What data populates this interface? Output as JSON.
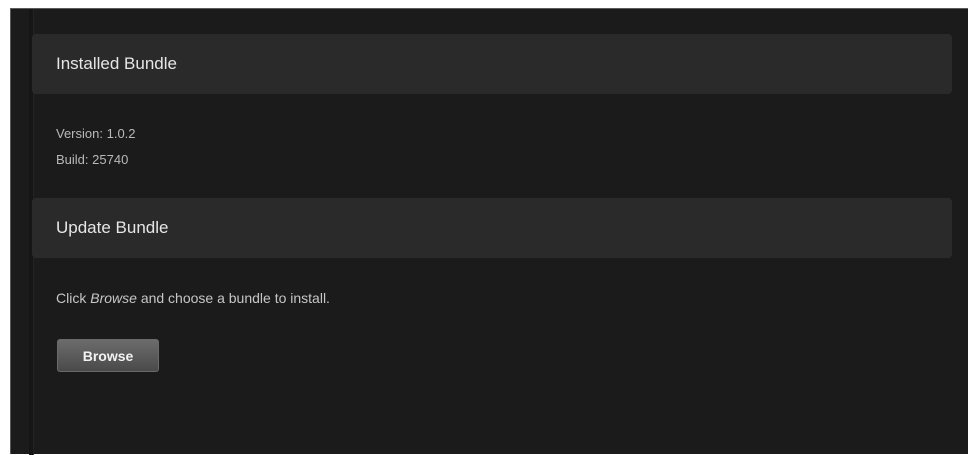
{
  "installed": {
    "header": "Installed Bundle",
    "version_label": "Version:",
    "version_value": "1.0.2",
    "build_label": "Build:",
    "build_value": "25740"
  },
  "update": {
    "header": "Update Bundle",
    "instruction_prefix": "Click",
    "instruction_emphasis": "Browse",
    "instruction_suffix": "and choose a bundle to install.",
    "browse_label": "Browse"
  },
  "colors": {
    "panel_background": "#1b1b1b",
    "header_background": "#2a2a2a",
    "button_gradient_top": "#6c6c6c",
    "button_gradient_bottom": "#4a4a4a"
  }
}
